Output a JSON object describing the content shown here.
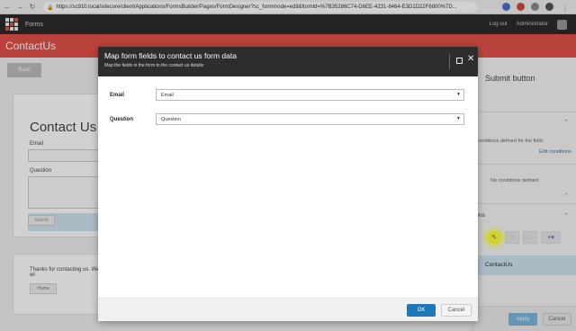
{
  "browser": {
    "url": "https://sc910.local/sitecore/client/Applications/FormsBuilder/Pages/FormDesigner?sc_formmode=edit&formId=%7B35286C74-D6EE-4231-8464-E3D1D22F6800%7D...",
    "extensions": [
      "blue-extension-icon",
      "red-extension-icon",
      "gray-extension-icon",
      "dark-extension-icon",
      "menu-icon"
    ]
  },
  "app": {
    "name": "Forms",
    "logout_label": "Log out",
    "user_label": "Administrator"
  },
  "page": {
    "title": "ContactUs",
    "back_label": "Back"
  },
  "background_form": {
    "title": "Contact Us",
    "email_label": "Email",
    "question_label": "Question",
    "submit_label": "Submit",
    "thanks_text": "Thanks for contacting us. We wi",
    "home_label": "Home"
  },
  "right_panel": {
    "title": "Submit button",
    "conditions_text": "e conditions defined for the field.",
    "edit_conditions_link": "Edit conditions",
    "no_conditions_text": "No conditions defined.",
    "actions_heading": "tions",
    "selected_action": "ContactUs",
    "apply_label": "Apply",
    "cancel_label": "Cancel"
  },
  "modal": {
    "title": "Map form fields to contact us form data",
    "subtitle": "Map the fields in the form to the contact us details",
    "fields": [
      {
        "label": "Email",
        "selected": "Email"
      },
      {
        "label": "Question",
        "selected": "Question"
      }
    ],
    "ok_label": "OK",
    "cancel_label": "Cancel"
  }
}
